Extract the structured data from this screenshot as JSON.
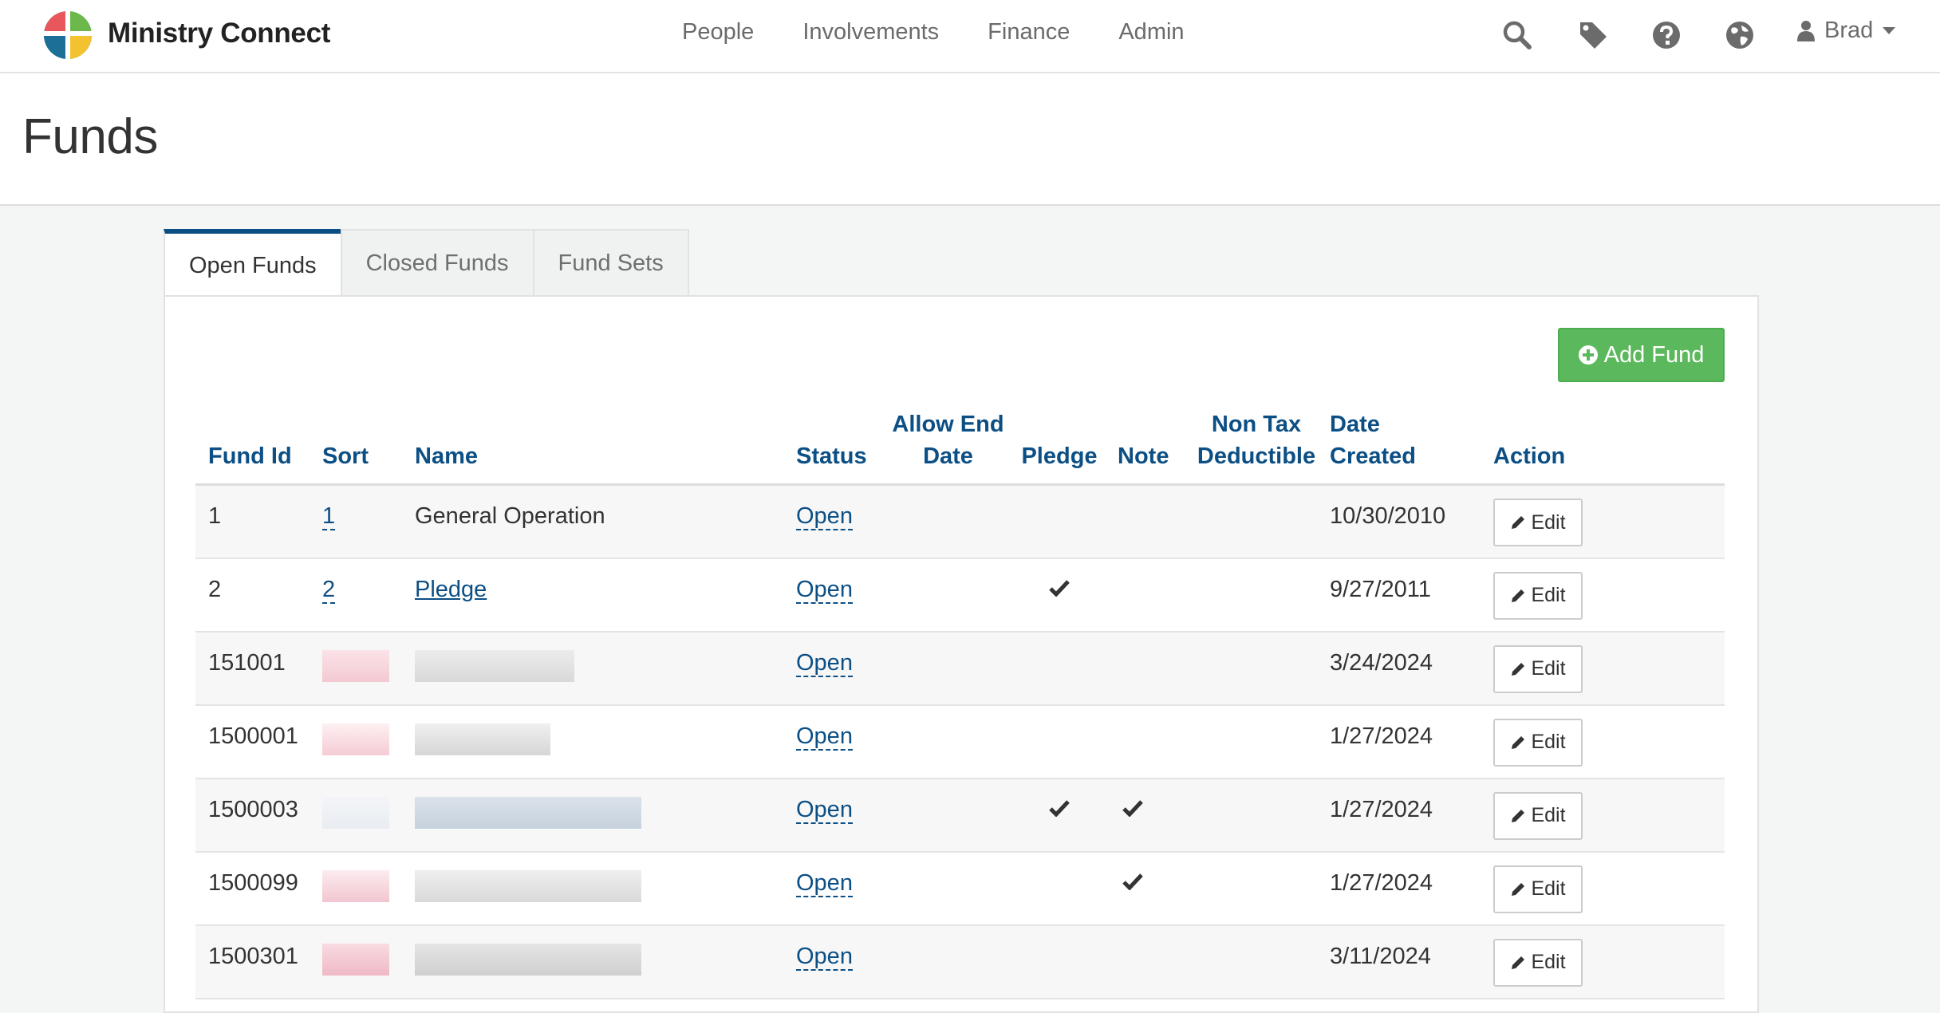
{
  "app": {
    "brand": "Ministry Connect"
  },
  "nav": {
    "links": [
      "People",
      "Involvements",
      "Finance",
      "Admin"
    ],
    "user": "Brad"
  },
  "page": {
    "title": "Funds"
  },
  "tabs": [
    "Open Funds",
    "Closed Funds",
    "Fund Sets"
  ],
  "actions": {
    "add_fund": "Add Fund"
  },
  "table": {
    "headers": {
      "fund_id": "Fund Id",
      "sort": "Sort",
      "name": "Name",
      "status": "Status",
      "allow_end_date_1": "Allow End",
      "allow_end_date_2": "Date",
      "pledge": "Pledge",
      "note": "Note",
      "non_tax_1": "Non Tax",
      "non_tax_2": "Deductible",
      "date_created_1": "Date",
      "date_created_2": "Created",
      "action": "Action"
    },
    "rows": [
      {
        "fund_id": "1",
        "sort": "1",
        "name": "General Operation",
        "status": "Open",
        "pledge": false,
        "note": false,
        "date_created": "10/30/2010",
        "edit": "Edit"
      },
      {
        "fund_id": "2",
        "sort": "2",
        "name": "Pledge",
        "status": "Open",
        "pledge": true,
        "note": false,
        "date_created": "9/27/2011",
        "edit": "Edit"
      },
      {
        "fund_id": "151001",
        "sort": "",
        "name": "",
        "status": "Open",
        "pledge": false,
        "note": false,
        "date_created": "3/24/2024",
        "edit": "Edit"
      },
      {
        "fund_id": "1500001",
        "sort": "",
        "name": "",
        "status": "Open",
        "pledge": false,
        "note": false,
        "date_created": "1/27/2024",
        "edit": "Edit"
      },
      {
        "fund_id": "1500003",
        "sort": "",
        "name": "",
        "status": "Open",
        "pledge": true,
        "note": true,
        "date_created": "1/27/2024",
        "edit": "Edit"
      },
      {
        "fund_id": "1500099",
        "sort": "",
        "name": "",
        "status": "Open",
        "pledge": false,
        "note": true,
        "date_created": "1/27/2024",
        "edit": "Edit"
      },
      {
        "fund_id": "1500301",
        "sort": "",
        "name": "",
        "status": "Open",
        "pledge": false,
        "note": false,
        "date_created": "3/11/2024",
        "edit": "Edit"
      }
    ]
  },
  "colors": {
    "header_blue": "#0c4f85",
    "add_green": "#5cb85c",
    "tab_active_border": "#0c4f85"
  },
  "icons": [
    "search-icon",
    "tag-icon",
    "help-icon",
    "globe-icon",
    "user-icon",
    "check-icon",
    "pencil-icon",
    "plus-circle-icon"
  ]
}
